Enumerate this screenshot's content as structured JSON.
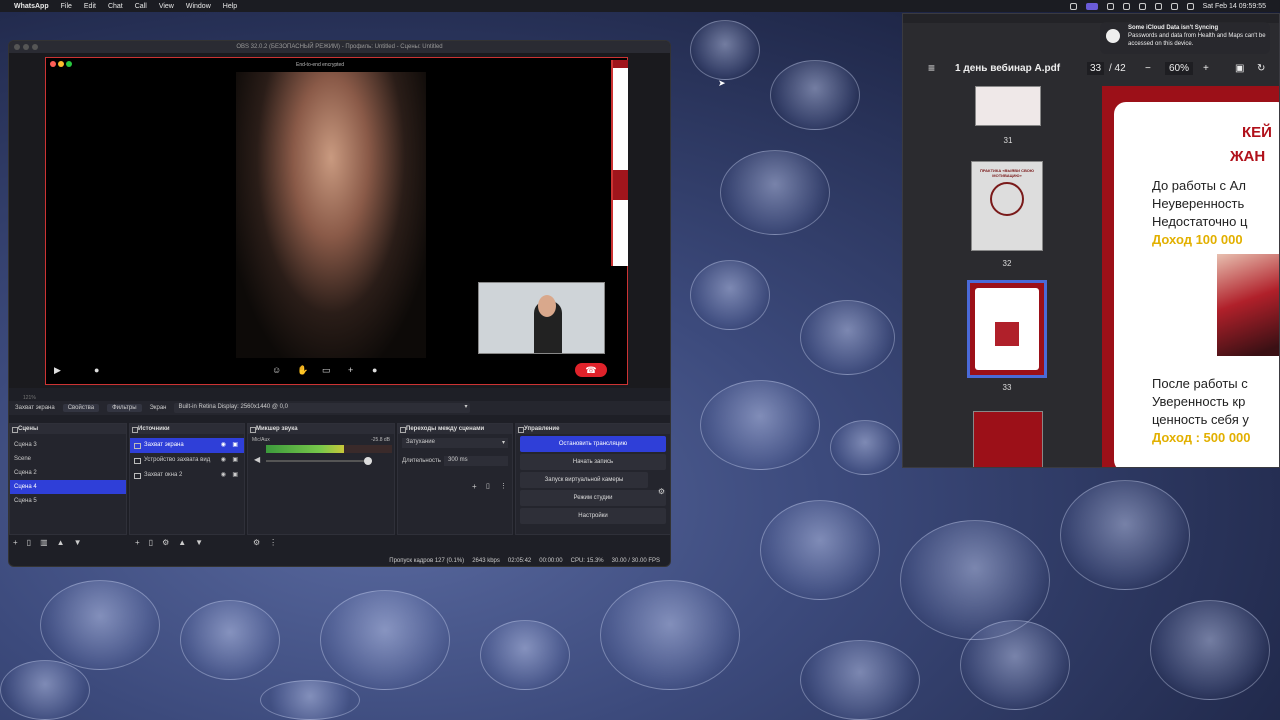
{
  "menubar": {
    "app": "WhatsApp",
    "items": [
      "File",
      "Edit",
      "Chat",
      "Call",
      "View",
      "Window",
      "Help"
    ],
    "datetime": "Sat Feb 14  09:59:55"
  },
  "obs": {
    "title": "OBS 32.0.2 (БЕЗОПАСНЫЙ РЕЖИМ) - Профиль: Untitled - Сцены: Untitled",
    "meet_banner": "End-to-end encrypted",
    "preview_footer": "121%",
    "toolbar": {
      "source": "Захват экрана",
      "properties": "Свойства",
      "filters": "Фильтры",
      "screen_label": "Экран",
      "display": "Built-in Retina Display: 2560x1440 @ 0,0"
    },
    "scenes": {
      "title": "Сцены",
      "items": [
        "Сцена 3",
        "Scene",
        "Сцена 2",
        "Сцена 4",
        "Сцена 5"
      ],
      "selected": 3
    },
    "sources": {
      "title": "Источники",
      "items": [
        "Захват экрана",
        "Устройство захвата вид",
        "Захват окна 2"
      ],
      "selected": 0
    },
    "mixer": {
      "title": "Микшер звука",
      "channel": "Mic/Aux",
      "db": "-25.8 dB",
      "level": 0.62
    },
    "transitions": {
      "title": "Переходы между сценами",
      "type": "Затухание",
      "duration_label": "Длительность",
      "duration": "300 ms"
    },
    "controls": {
      "title": "Управление",
      "buttons": [
        "Остановить трансляцию",
        "Начать запись",
        "Запуск виртуальной камеры",
        "Режим студии",
        "Настройки"
      ]
    },
    "status": {
      "dropped": "Пропуск кадров 127 (0.1%)",
      "bitrate": "2643 kbps",
      "stream_time": "02:05:42",
      "rec_time": "00:00:00",
      "cpu": "CPU: 15.3%",
      "fps": "30.00 / 30.00 FPS"
    }
  },
  "pdf": {
    "filename": "1 день вебинар A.pdf",
    "page": "33",
    "page_total": "/ 42",
    "zoom": "60%",
    "thumbs": [
      {
        "num": "31"
      },
      {
        "num": "32",
        "text": "ПРАКТИКА «ВЫЯВИ СВОЮ МОТИВАЦИЮ»"
      },
      {
        "num": "33"
      }
    ],
    "page_text": {
      "head1": "КЕЙ",
      "head2": "ЖАН",
      "l1": "До работы с Ал",
      "l2": "Неуверенность",
      "l3": "Недостаточно ц",
      "l4": "Доход 100 000",
      "l5": "После работы с",
      "l6": "Уверенность кр",
      "l7": "ценность себя у",
      "l8": "Доход : 500 000"
    }
  },
  "notification": {
    "title": "Some iCloud Data isn't Syncing",
    "body": "Passwords and data from Health and Maps can't be accessed on this device."
  },
  "colors": {
    "accent": "#2f3fd8",
    "hangup": "#e0222a",
    "pdf_red": "#9c1018"
  }
}
